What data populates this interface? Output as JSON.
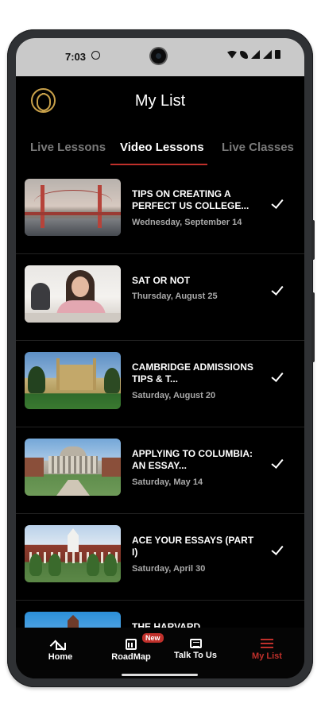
{
  "status_bar": {
    "time": "7:03"
  },
  "header": {
    "title": "My List"
  },
  "tabs": [
    {
      "label": "Live Lessons",
      "active": false
    },
    {
      "label": "Video Lessons",
      "active": true
    },
    {
      "label": "Live Classes",
      "active": false
    }
  ],
  "items": [
    {
      "title": "TIPS ON CREATING A PERFECT US COLLEGE...",
      "date": "Wednesday, September 14",
      "thumb": "golden-gate-bridge"
    },
    {
      "title": "SAT OR NOT",
      "date": "Thursday, August 25",
      "thumb": "students-taking-exam"
    },
    {
      "title": "CAMBRIDGE ADMISSIONS TIPS & T...",
      "date": "Saturday, August 20",
      "thumb": "cambridge-college"
    },
    {
      "title": "APPLYING TO COLUMBIA: AN ESSAY...",
      "date": "Saturday, May 14",
      "thumb": "columbia-library"
    },
    {
      "title": "ACE YOUR ESSAYS (PART I)",
      "date": "Saturday, April 30",
      "thumb": "dartmouth-hall"
    },
    {
      "title": "THE HARVARD",
      "date": "",
      "thumb": "harvard-tower"
    }
  ],
  "bottom_nav": [
    {
      "label": "Home",
      "icon": "home-icon",
      "active": false
    },
    {
      "label": "RoadMap",
      "icon": "calendar-icon",
      "active": false,
      "badge": "New"
    },
    {
      "label": "Talk To Us",
      "icon": "chat-icon",
      "active": false
    },
    {
      "label": "My List",
      "icon": "list-icon",
      "active": true
    }
  ],
  "colors": {
    "accent": "#c0302b",
    "background": "#000000",
    "logo_gold": "#c9a14a"
  }
}
